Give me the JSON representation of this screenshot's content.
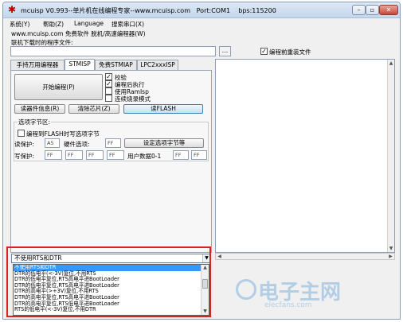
{
  "window": {
    "title": "mcuisp V0.993--单片机在线编程专家--www.mcuisp.com",
    "port": "Port:COM1",
    "baud": "bps:115200"
  },
  "menu": {
    "items": [
      "系统(Y)",
      "帮助(Z)",
      "Language",
      "搜索串口(X)"
    ]
  },
  "subline": "www.mcuisp.com 免费软件 脱机/高速编程器(W)",
  "file": {
    "label": "联机下载时的程序文件:",
    "path": "",
    "browse": "...",
    "reload_label": "编程前重装文件",
    "reload_checked": true
  },
  "tabs": [
    "手持万用编程器",
    "STMISP",
    "免费STMIAP",
    "LPC2xxxISP"
  ],
  "stmisp": {
    "start_button": "开始编程(P)",
    "options": [
      {
        "label": "校验",
        "checked": true
      },
      {
        "label": "编程后执行",
        "checked": true
      },
      {
        "label": "使用RamIsp",
        "checked": false
      },
      {
        "label": "连续烧录模式",
        "checked": false
      }
    ],
    "read_info_button": "读器件信息(R)",
    "erase_button": "清除芯片(Z)",
    "read_flash_button": "读FLASH",
    "option_group": {
      "title": "选项字节区:",
      "write_checkbox": "编程到FLASH时写选项字节",
      "read_protect_label": "读保护:",
      "read_protect_value": "A5",
      "hw_option_label": "硬件选项:",
      "hw_option_value": "FF",
      "set_button": "设定选项字节等",
      "write_protect_label": "写保护:",
      "wp_values": [
        "FF",
        "FF",
        "FF",
        "FF"
      ],
      "user_data_label": "用户数据0-1",
      "user_data_values": [
        "FF",
        "FF"
      ]
    }
  },
  "dtr_rts": {
    "selected": "不使用RTS和DTR",
    "options": [
      "不使用RTS和DTR",
      "DTR的低电平(<-3V)复位,不用RTS",
      "DTR的低电平复位,RTS高电平进BootLoader",
      "DTR的低电平复位,RTS高电平进BootLoader",
      "DTR的高电平(>+3V)复位,不用RTS",
      "DTR的高电平复位,RTS高电平进BootLoader",
      "DTR的高电平复位,RTS低电平进BootLoader",
      "RTS的低电平(<-3V)复位,不用DTR"
    ]
  },
  "watermark": {
    "text": "电子主网",
    "url": "elecfans.com"
  },
  "colors": {
    "titlebar": "#c4d7ec",
    "selection": "#3399ff",
    "highlight": "#e02020"
  }
}
